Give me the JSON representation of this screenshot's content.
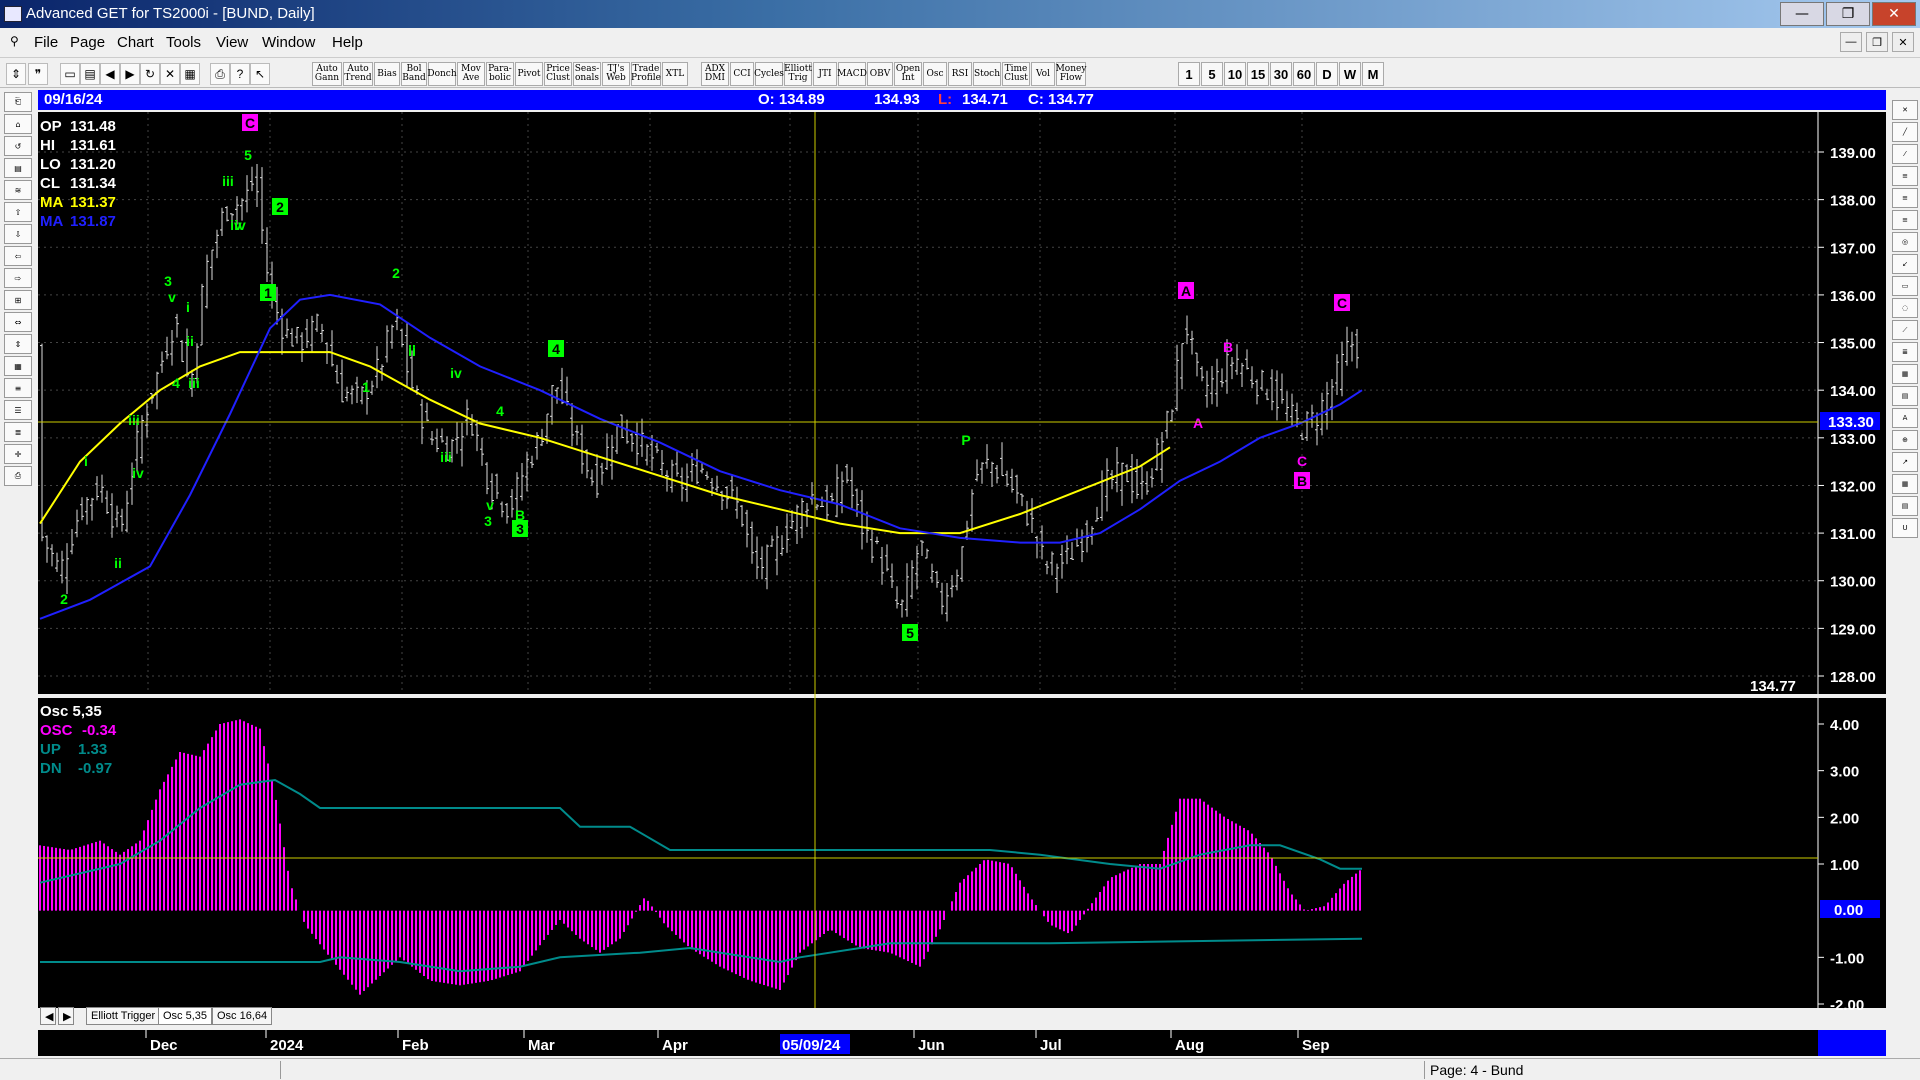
{
  "window": {
    "title": "Advanced GET for TS2000i - [BUND, Daily]"
  },
  "window_buttons": [
    "—",
    "❐",
    "✕"
  ],
  "menu": [
    "File",
    "Page",
    "Chart",
    "Tools",
    "View",
    "Window",
    "Help"
  ],
  "toolbar": {
    "studies": [
      "Auto Gann",
      "Auto Trend",
      "Bias",
      "Bol Band",
      "Donch",
      "Mov Ave",
      "Para- bolic",
      "Pivot",
      "Price Clust",
      "Seas- onals",
      "TJ's Web",
      "Trade Profile",
      "XTL",
      "ADX DMI",
      "CCI",
      "Cycles",
      "Elliott Trig",
      "JTI",
      "MACD",
      "OBV",
      "Open Int",
      "Osc",
      "RSI",
      "Stoch",
      "Time Clust",
      "Vol",
      "Money Flow"
    ],
    "periods": [
      "1",
      "5",
      "10",
      "15",
      "30",
      "60",
      "D",
      "W",
      "M"
    ]
  },
  "info_bar": {
    "date": "09/16/24",
    "open": "O: 134.89",
    "high": "134.93",
    "low_label": "L:",
    "low_value": "134.71",
    "close": "C: 134.77"
  },
  "legend": {
    "op": {
      "label": "OP",
      "value": "131.48"
    },
    "hi": {
      "label": "HI",
      "value": "131.61"
    },
    "lo": {
      "label": "LO",
      "value": "131.20"
    },
    "cl": {
      "label": "CL",
      "value": "131.34"
    },
    "ma1": {
      "label": "MA",
      "value": "131.37"
    },
    "ma2": {
      "label": "MA",
      "value": "131.87"
    }
  },
  "osc_legend": {
    "title": "Osc 5,35",
    "osc": {
      "label": "OSC",
      "value": "-0.34"
    },
    "up": {
      "label": "UP",
      "value": "1.33"
    },
    "dn": {
      "label": "DN",
      "value": "-0.97"
    }
  },
  "price_axis": [
    "139.00",
    "138.00",
    "137.00",
    "136.00",
    "135.00",
    "134.00",
    "133.00",
    "132.00",
    "131.00",
    "130.00",
    "129.00",
    "128.00"
  ],
  "price_cursor": "133.30",
  "last_price": "134.77",
  "osc_axis": [
    "4.00",
    "3.00",
    "2.00",
    "1.00",
    "-1.00",
    "-2.00"
  ],
  "osc_zero_label": "0.00",
  "date_axis": [
    "Dec",
    "2024",
    "Feb",
    "Mar",
    "Apr",
    "Jun",
    "Jul",
    "Aug",
    "Sep"
  ],
  "date_cursor": "05/09/24",
  "wave_labels": {
    "green_plain": [
      "2",
      "i",
      "ii",
      "iii",
      "iv",
      "3",
      "v",
      "i",
      "ii",
      "iii",
      "4",
      "iii",
      "iv",
      "5",
      "iv",
      "2",
      "ii",
      "1",
      "iv",
      "iii",
      "4",
      "v",
      "3",
      "B",
      "1",
      "ii",
      "P"
    ],
    "green_boxed": [
      "2",
      "1",
      "4",
      "3",
      "5"
    ],
    "magenta_plain": [
      "A",
      "B",
      "A",
      "C"
    ],
    "magenta_boxed": [
      "C",
      "A",
      "C",
      "B"
    ]
  },
  "tabs": [
    "Elliott Trigger",
    "Osc 5,35",
    "Osc 16,64"
  ],
  "status": {
    "page": "Page: 4 - Bund"
  },
  "colors": {
    "background": "#000000",
    "info_bar": "#0000ff",
    "ma_fast": "#ffff00",
    "ma_slow": "#2020ff",
    "histogram": "#ff00ff",
    "bands": "#008b8b",
    "wave_labels": "#00ff00",
    "abc_labels": "#ff00ff"
  }
}
